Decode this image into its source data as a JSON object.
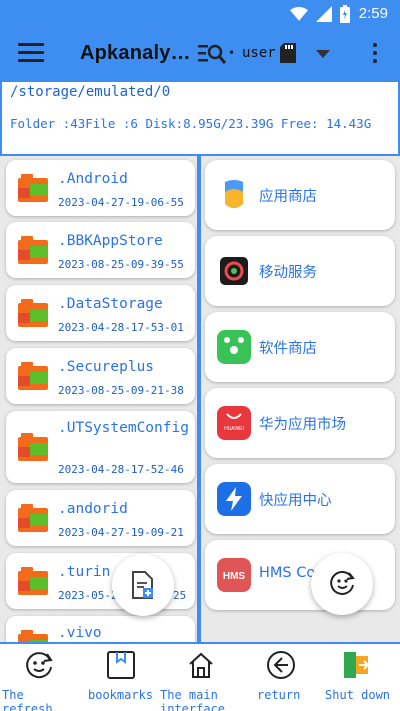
{
  "status_bar": {
    "time": "2:59",
    "icons": [
      "wifi-icon",
      "signal-icon",
      "battery-icon"
    ]
  },
  "toolbar": {
    "title": "Apkanaly…",
    "separator": "•",
    "storage_label": "user",
    "icons": [
      "menu-icon",
      "search-list-icon",
      "sd-card-icon",
      "chevron-down-icon",
      "more-vert-icon"
    ]
  },
  "path_info": {
    "path": "/storage/emulated/0",
    "summary": "Folder :43File :6    Disk:8.95G/23.39G  Free: 14.43G"
  },
  "folders": [
    {
      "name": ".Android",
      "date": "2023-04-27-19-06-55"
    },
    {
      "name": ".BBKAppStore",
      "date": "2023-08-25-09-39-55"
    },
    {
      "name": ".DataStorage",
      "date": "2023-04-28-17-53-01"
    },
    {
      "name": ".Secureplus",
      "date": "2023-08-25-09-21-38"
    },
    {
      "name": ".UTSystemConfig",
      "date": "2023-04-28-17-52-46"
    },
    {
      "name": ".andorid",
      "date": "2023-04-27-19-09-21"
    },
    {
      "name": ".turin",
      "date": "2023-05-2"
    },
    {
      "name": ".vivo",
      "date": ""
    }
  ],
  "folder_date_tail": "25",
  "apps": [
    {
      "name": "应用商店",
      "icon": "app-store-icon"
    },
    {
      "name": "移动服务",
      "icon": "mobile-services-icon"
    },
    {
      "name": "软件商店",
      "icon": "software-store-icon",
      "color": "#39c255"
    },
    {
      "name": "华为应用市场",
      "icon": "huawei-appgallery-icon",
      "color": "#e8383d",
      "badge": "HUAWEI"
    },
    {
      "name": "快应用中心",
      "icon": "quick-app-center-icon",
      "color": "#1d6fe8"
    },
    {
      "name": "HMS Co",
      "icon": "hms-core-icon",
      "color": "#e05555",
      "badge": "HMS"
    }
  ],
  "bottom_nav": [
    {
      "label": "The refresh",
      "icon": "refresh-face-icon"
    },
    {
      "label": "bookmarks",
      "icon": "bookmark-icon"
    },
    {
      "label": "The main interface",
      "icon": "home-icon"
    },
    {
      "label": "return",
      "icon": "back-arrow-icon"
    },
    {
      "label": "Shut down",
      "icon": "exit-icon"
    }
  ],
  "colors": {
    "primary": "#3d8ef0",
    "text_blue": "#2a73e8",
    "folder_orange": "#f26a1b",
    "folder_green": "#5cbf2a"
  }
}
